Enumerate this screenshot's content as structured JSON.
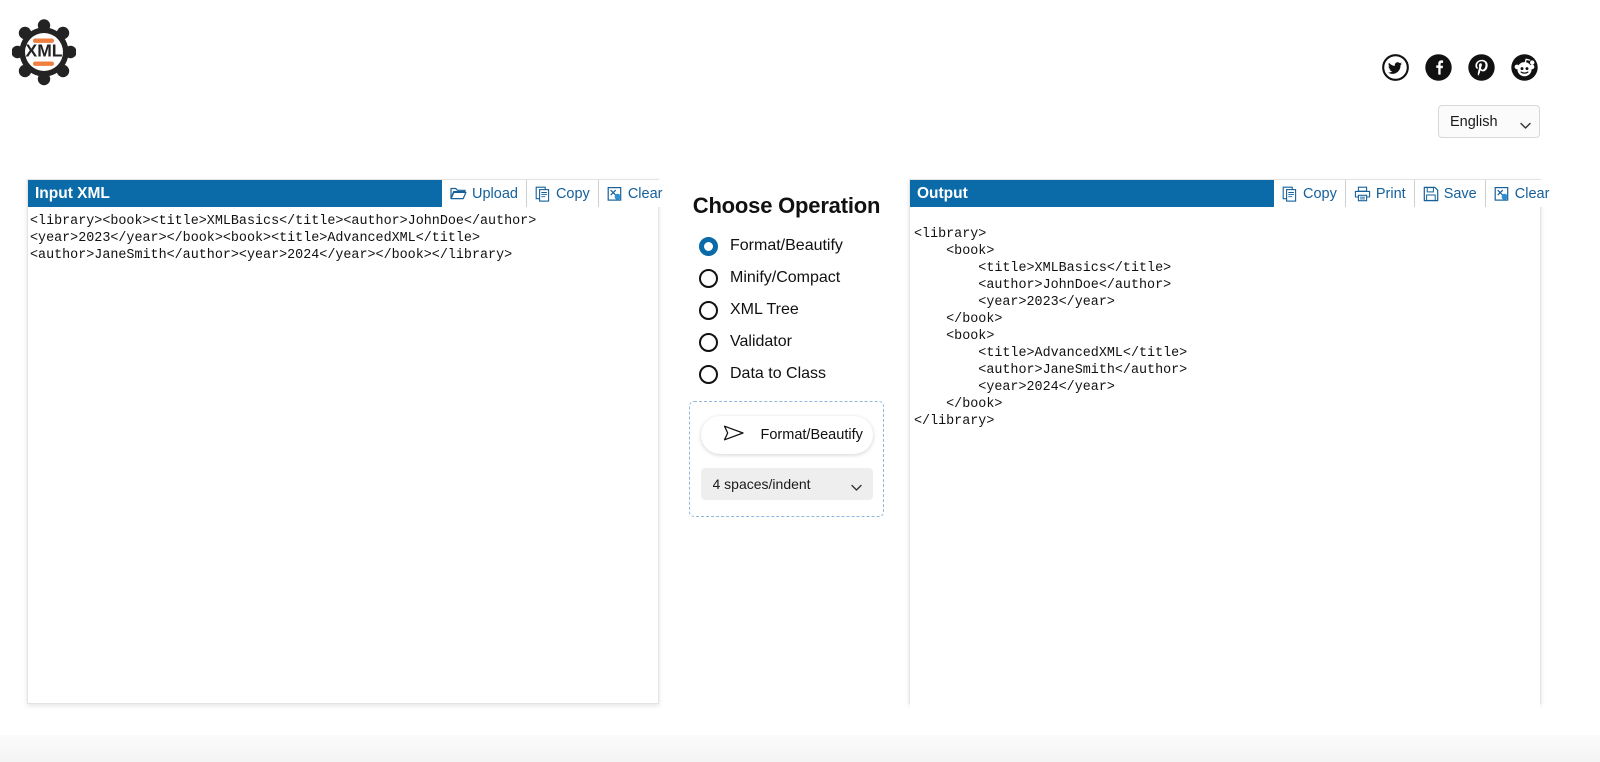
{
  "header": {
    "logo_text": "XML",
    "logo_name": "xml-gear-logo",
    "social": [
      {
        "name": "twitter-icon",
        "label": "Twitter"
      },
      {
        "name": "facebook-icon",
        "label": "Facebook"
      },
      {
        "name": "pinterest-icon",
        "label": "Pinterest"
      },
      {
        "name": "reddit-icon",
        "label": "Reddit"
      }
    ],
    "language": {
      "selected": "English",
      "options": [
        "English"
      ]
    }
  },
  "input_panel": {
    "title": "Input XML",
    "tools": [
      {
        "label": "Upload",
        "icon": "folder-open-icon"
      },
      {
        "label": "Copy",
        "icon": "copy-document-icon"
      },
      {
        "label": "Clear",
        "icon": "clear-eraser-icon"
      }
    ],
    "content": "<library><book><title>XMLBasics</title><author>JohnDoe</author>\n<year>2023</year></book><book><title>AdvancedXML</title>\n<author>JaneSmith</author><year>2024</year></book></library>",
    "placeholder": ""
  },
  "operations": {
    "title": "Choose Operation",
    "options": [
      {
        "label": "Format/Beautify",
        "selected": true
      },
      {
        "label": "Minify/Compact",
        "selected": false
      },
      {
        "label": "XML Tree",
        "selected": false
      },
      {
        "label": "Validator",
        "selected": false
      },
      {
        "label": "Data to Class",
        "selected": false
      }
    ],
    "run_button": {
      "label": "Format/Beautify",
      "icon": "send-arrow-icon"
    },
    "indent": {
      "selected": "4 spaces/indent",
      "options": [
        "4 spaces/indent"
      ]
    }
  },
  "output_panel": {
    "title": "Output",
    "tools": [
      {
        "label": "Copy",
        "icon": "copy-document-icon"
      },
      {
        "label": "Print",
        "icon": "printer-icon"
      },
      {
        "label": "Save",
        "icon": "floppy-disk-icon"
      },
      {
        "label": "Clear",
        "icon": "clear-eraser-icon"
      }
    ],
    "content": "<library>\n    <book>\n        <title>XMLBasics</title>\n        <author>JohnDoe</author>\n        <year>2023</year>\n    </book>\n    <book>\n        <title>AdvancedXML</title>\n        <author>JaneSmith</author>\n        <year>2024</year>\n    </book>\n</library>"
  },
  "colors": {
    "panel_header_blue": "#0b6aa8",
    "tool_link_blue": "#15609b",
    "radio_selected_blue": "#0b6aa8",
    "dashed_border_blue": "#8fb8dd",
    "logo_orange": "#ee7f3f",
    "logo_dark": "#232323"
  }
}
